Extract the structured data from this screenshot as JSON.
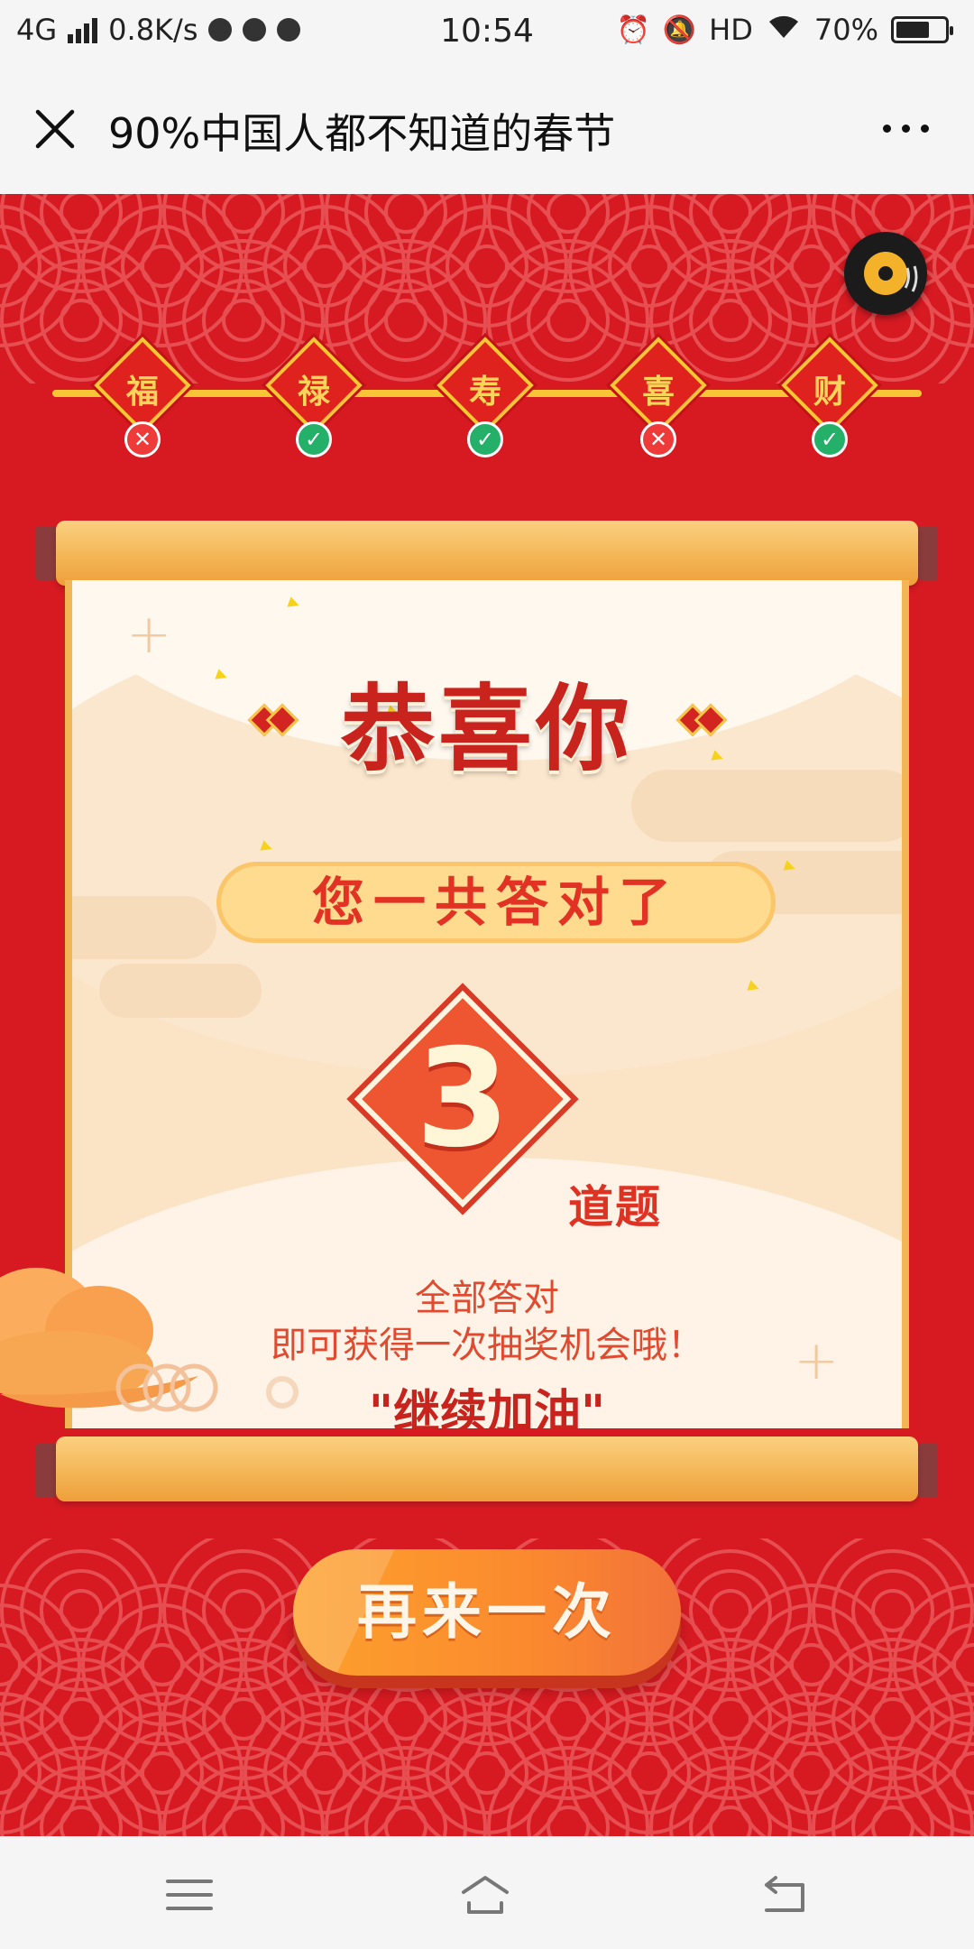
{
  "status_bar": {
    "network": "4G",
    "speed": "0.8K/s",
    "time": "10:54",
    "hd": "HD",
    "battery": "70%",
    "battery_level": 0.7
  },
  "title_bar": {
    "title": "90%中国人都不知道的春节"
  },
  "progress": {
    "nodes": [
      {
        "char": "福",
        "result": "wrong",
        "mark": "✕"
      },
      {
        "char": "禄",
        "result": "right",
        "mark": "✓"
      },
      {
        "char": "寿",
        "result": "right",
        "mark": "✓"
      },
      {
        "char": "喜",
        "result": "wrong",
        "mark": "✕"
      },
      {
        "char": "财",
        "result": "right",
        "mark": "✓"
      }
    ]
  },
  "result": {
    "heading": "恭喜你",
    "subheading": "您一共答对了",
    "score": "3",
    "score_unit": "道题",
    "hint_line1": "全部答对",
    "hint_line2": "即可获得一次抽奖机会哦！",
    "cheer": "\"继续加油\""
  },
  "actions": {
    "again_label": "再来一次"
  },
  "colors": {
    "background_red": "#d71a22",
    "gold": "#f7c535",
    "button_orange": "#fb8a2e"
  }
}
